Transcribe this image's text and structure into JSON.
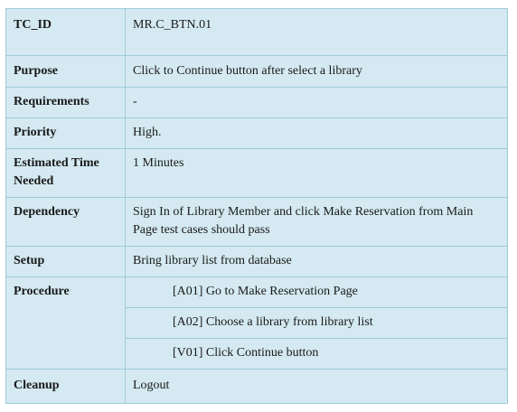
{
  "rows": {
    "tc_id": {
      "label": "TC_ID",
      "value": "MR.C_BTN.01"
    },
    "purpose": {
      "label": "Purpose",
      "value": "Click to Continue button after select a library"
    },
    "requirements": {
      "label": "Requirements",
      "value": "-"
    },
    "priority": {
      "label": "Priority",
      "value": "High."
    },
    "estimated_time": {
      "label": "Estimated Time Needed",
      "value": "1 Minutes"
    },
    "dependency": {
      "label": "Dependency",
      "value": "Sign In of Library Member and click Make Reservation from Main Page test cases should pass"
    },
    "setup": {
      "label": "Setup",
      "value": "Bring library list from database"
    },
    "procedure": {
      "label": "Procedure",
      "steps": [
        "[A01] Go to Make Reservation Page",
        "[A02] Choose a library from library list",
        "[V01] Click Continue button"
      ]
    },
    "cleanup": {
      "label": "Cleanup",
      "value": "Logout"
    }
  },
  "colors": {
    "cell_background": "#d4e9f1",
    "border": "#9fcbdb",
    "text": "#1a1a1a"
  }
}
